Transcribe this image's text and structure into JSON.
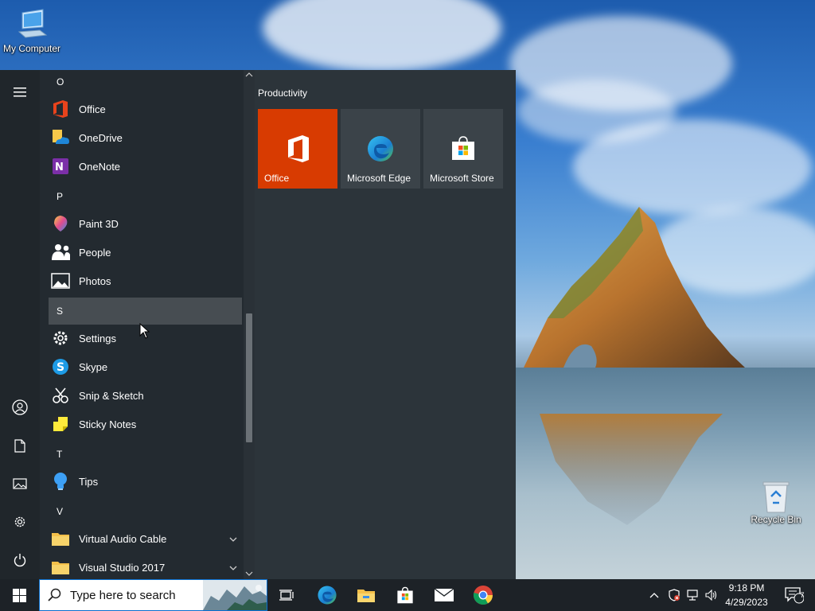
{
  "desktop": {
    "icons": [
      {
        "label": "My Computer",
        "icon": "computer-icon"
      },
      {
        "label": "Recycle Bin",
        "icon": "recycle-bin-icon"
      }
    ]
  },
  "start_menu": {
    "rail": [
      {
        "name": "hamburger-menu-icon"
      },
      {
        "name": "user-account-icon"
      },
      {
        "name": "documents-icon"
      },
      {
        "name": "pictures-icon"
      },
      {
        "name": "settings-gear-icon"
      },
      {
        "name": "power-icon"
      }
    ],
    "app_list": [
      {
        "type": "letter",
        "text": "O"
      },
      {
        "type": "app",
        "label": "Office",
        "icon": "office-icon"
      },
      {
        "type": "app",
        "label": "OneDrive",
        "icon": "onedrive-icon"
      },
      {
        "type": "app",
        "label": "OneNote",
        "icon": "onenote-icon"
      },
      {
        "type": "letter",
        "text": "P"
      },
      {
        "type": "app",
        "label": "Paint 3D",
        "icon": "paint-3d-icon"
      },
      {
        "type": "app",
        "label": "People",
        "icon": "people-icon"
      },
      {
        "type": "app",
        "label": "Photos",
        "icon": "photos-icon"
      },
      {
        "type": "letter",
        "text": "S",
        "highlighted": true
      },
      {
        "type": "app",
        "label": "Settings",
        "icon": "settings-icon"
      },
      {
        "type": "app",
        "label": "Skype",
        "icon": "skype-icon"
      },
      {
        "type": "app",
        "label": "Snip & Sketch",
        "icon": "snip-sketch-icon"
      },
      {
        "type": "app",
        "label": "Sticky Notes",
        "icon": "sticky-notes-icon"
      },
      {
        "type": "letter",
        "text": "T"
      },
      {
        "type": "app",
        "label": "Tips",
        "icon": "tips-icon"
      },
      {
        "type": "letter",
        "text": "V"
      },
      {
        "type": "folder",
        "label": "Virtual Audio Cable",
        "icon": "folder-icon"
      },
      {
        "type": "folder",
        "label": "Visual Studio 2017",
        "icon": "folder-icon"
      }
    ],
    "tile_group": {
      "title": "Productivity",
      "tiles": [
        {
          "label": "Office",
          "icon": "office-icon",
          "bg": "#d83b01"
        },
        {
          "label": "Microsoft Edge",
          "icon": "edge-icon",
          "bg": "#3b4349"
        },
        {
          "label": "Microsoft Store",
          "icon": "store-icon",
          "bg": "#3b4349"
        }
      ]
    }
  },
  "taskbar": {
    "search_placeholder": "Type here to search",
    "pinned": [
      {
        "name": "task-view-icon"
      },
      {
        "name": "edge-icon"
      },
      {
        "name": "file-explorer-icon"
      },
      {
        "name": "store-icon"
      },
      {
        "name": "mail-icon"
      },
      {
        "name": "chrome-icon"
      }
    ],
    "clock": {
      "time": "9:18 PM",
      "date": "4/29/2023"
    },
    "notification_count": "7"
  },
  "colors": {
    "accent": "#0078d7",
    "office_tile": "#d83b01",
    "start_bg": "#232a30",
    "taskbar_bg": "#1d2227"
  }
}
